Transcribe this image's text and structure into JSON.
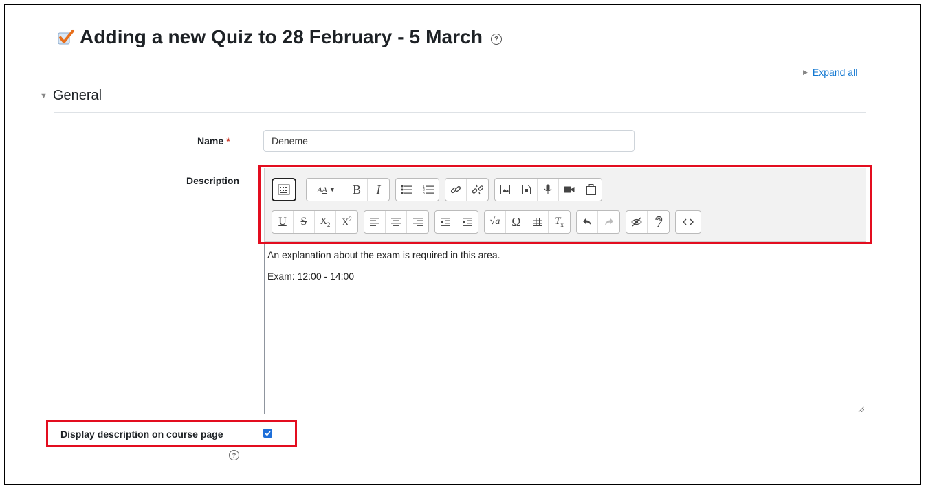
{
  "page": {
    "title": "Adding a new Quiz to 28 February - 5 March",
    "expand_all": "Expand all",
    "section": "General"
  },
  "form": {
    "name_label": "Name",
    "required_mark": "*",
    "name_value": "Deneme",
    "description_label": "Description",
    "description_lines": [
      "An explanation about the exam is required in this area.",
      "Exam: 12:00 - 14:00"
    ],
    "display_description_label": "Display description on course page",
    "display_description_checked": true
  },
  "toolbar": {
    "row1": [
      [
        "show-more-buttons"
      ],
      [
        "font-size",
        "bold",
        "italic"
      ],
      [
        "unordered-list",
        "ordered-list"
      ],
      [
        "link",
        "unlink"
      ],
      [
        "insert-image",
        "insert-media",
        "record-audio",
        "record-video",
        "manage-files"
      ]
    ],
    "row2": [
      [
        "underline",
        "strikethrough",
        "subscript",
        "superscript"
      ],
      [
        "align-left",
        "align-center",
        "align-right"
      ],
      [
        "outdent",
        "indent"
      ],
      [
        "equation",
        "special-character",
        "table",
        "clear-formatting"
      ],
      [
        "undo",
        "redo"
      ],
      [
        "accessibility-checker",
        "screenreader-helper"
      ],
      [
        "html-source"
      ]
    ]
  },
  "colors": {
    "link": "#1177d1",
    "highlight_box": "#e30d1f",
    "required": "#ca3120",
    "checkbox": "#1e6fd9"
  }
}
